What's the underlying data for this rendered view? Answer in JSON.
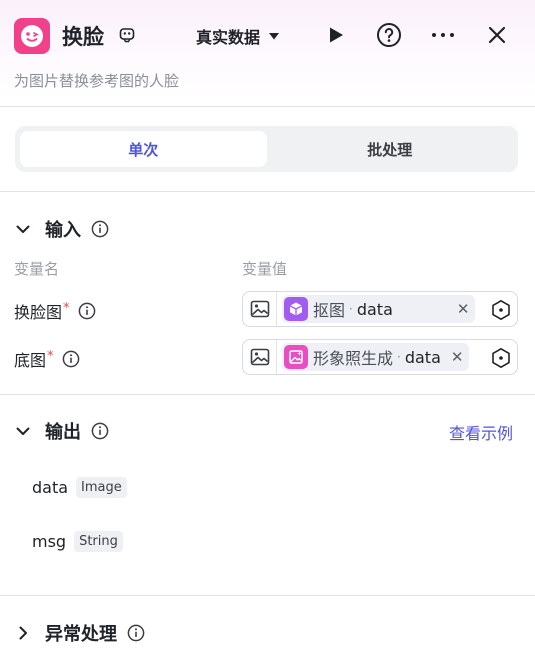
{
  "header": {
    "title": "换脸",
    "mode_label": "真实数据",
    "subtitle": "为图片替换参考图的人脸"
  },
  "tabs": [
    {
      "label": "单次",
      "active": true
    },
    {
      "label": "批处理",
      "active": false
    }
  ],
  "input_section": {
    "title": "输入",
    "col_name": "变量名",
    "col_value": "变量值",
    "rows": [
      {
        "label": "换脸图",
        "required_mark": "*",
        "node_name": "抠图",
        "dot": "·",
        "var_name": "data",
        "node_icon_color": "#a35cf0"
      },
      {
        "label": "底图",
        "required_mark": "*",
        "node_name": "形象照生成",
        "dot": "·",
        "var_name": "data",
        "node_icon_color": "#e84ec2"
      }
    ]
  },
  "output_section": {
    "title": "输出",
    "example_link": "查看示例",
    "rows": [
      {
        "name": "data",
        "type": "Image"
      },
      {
        "name": "msg",
        "type": "String"
      }
    ]
  },
  "error_section": {
    "title": "异常处理"
  },
  "colors": {
    "accent": "#4e56d8",
    "app_icon": "#f0418a",
    "required": "#e5484d"
  }
}
